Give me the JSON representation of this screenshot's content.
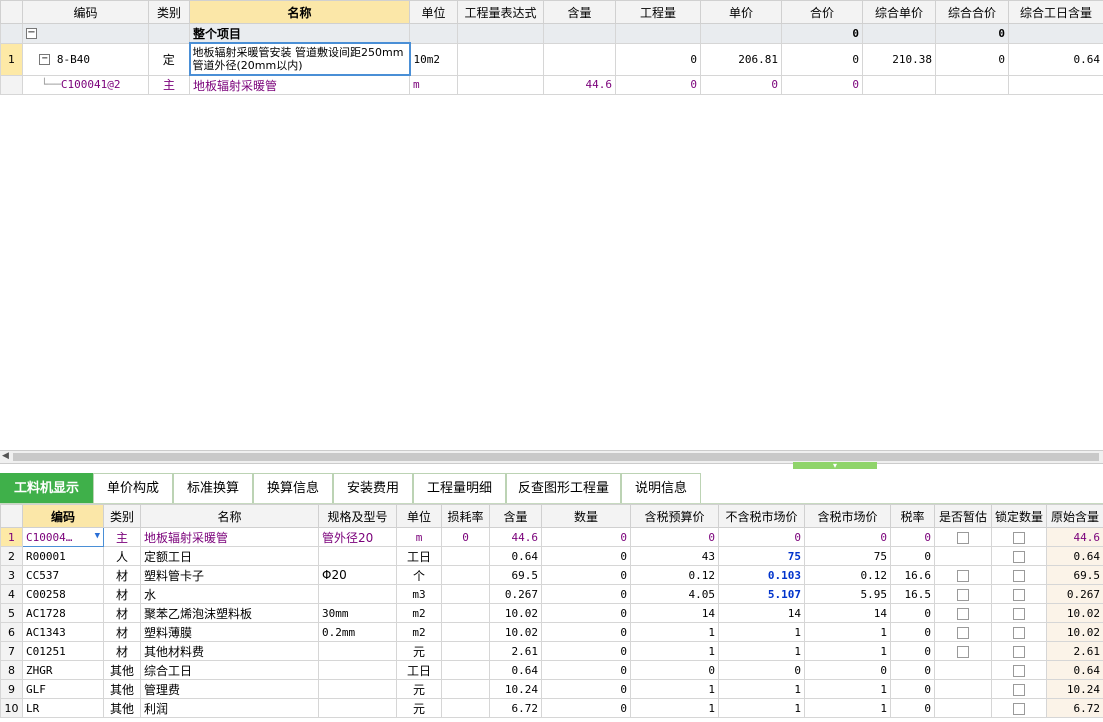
{
  "top_table": {
    "headers": [
      "编码",
      "类别",
      "名称",
      "单位",
      "工程量表达式",
      "含量",
      "工程量",
      "单价",
      "合价",
      "综合单价",
      "综合合价",
      "综合工日含量"
    ],
    "group_row": {
      "toggle": "−",
      "name": "整个项目",
      "合价": "0",
      "综合合价": "0"
    },
    "item_row": {
      "num": "1",
      "toggle": "−",
      "code": "8-B40",
      "type": "定",
      "name_line1": "地板辐射采暖管安装 管道敷设间距250mm",
      "name_line2": "管道外径(20mm以内)",
      "unit": "10m2",
      "expr": "",
      "qty_ratio": "",
      "qty": "0",
      "price": "206.81",
      "total": "0",
      "comp_price": "210.38",
      "comp_total": "0",
      "workday": "0.64"
    },
    "sub_row": {
      "code": "C100041@2",
      "type": "主",
      "name": "地板辐射采暖管",
      "unit": "m",
      "expr": "",
      "qty_ratio": "44.6",
      "qty": "0",
      "price": "0",
      "total": "0",
      "comp_price": "",
      "comp_total": "",
      "workday": ""
    }
  },
  "tabs": [
    "工料机显示",
    "单价构成",
    "标准换算",
    "换算信息",
    "安装费用",
    "工程量明细",
    "反查图形工程量",
    "说明信息"
  ],
  "bottom_table": {
    "headers": [
      "编码",
      "类别",
      "名称",
      "规格及型号",
      "单位",
      "损耗率",
      "含量",
      "数量",
      "含税预算价",
      "不含税市场价",
      "含税市场价",
      "税率",
      "是否暂估",
      "锁定数量",
      "原始含量"
    ],
    "rows": [
      {
        "n": "1",
        "code": "C10004…",
        "type": "主",
        "name": "地板辐射采暖管",
        "spec": "管外径20",
        "unit": "m",
        "loss": "0",
        "ratio": "44.6",
        "qty": "0",
        "budget": "0",
        "market": "0",
        "market_tax": "0",
        "tax": "0",
        "orig": "44.6"
      },
      {
        "n": "2",
        "code": "R00001",
        "type": "人",
        "name": "定额工日",
        "spec": "",
        "unit": "工日",
        "loss": "",
        "ratio": "0.64",
        "qty": "0",
        "budget": "43",
        "market": "75",
        "market_tax": "75",
        "tax": "0",
        "orig": "0.64"
      },
      {
        "n": "3",
        "code": "CC537",
        "type": "材",
        "name": "塑料管卡子",
        "spec": "Φ20",
        "unit": "个",
        "loss": "",
        "ratio": "69.5",
        "qty": "0",
        "budget": "0.12",
        "market": "0.103",
        "market_tax": "0.12",
        "tax": "16.6",
        "orig": "69.5"
      },
      {
        "n": "4",
        "code": "C00258",
        "type": "材",
        "name": "水",
        "spec": "",
        "unit": "m3",
        "loss": "",
        "ratio": "0.267",
        "qty": "0",
        "budget": "4.05",
        "market": "5.107",
        "market_tax": "5.95",
        "tax": "16.5",
        "orig": "0.267"
      },
      {
        "n": "5",
        "code": "AC1728",
        "type": "材",
        "name": "聚苯乙烯泡沫塑料板",
        "spec": "30mm",
        "unit": "m2",
        "loss": "",
        "ratio": "10.02",
        "qty": "0",
        "budget": "14",
        "market": "14",
        "market_tax": "14",
        "tax": "0",
        "orig": "10.02"
      },
      {
        "n": "6",
        "code": "AC1343",
        "type": "材",
        "name": "塑料薄膜",
        "spec": "0.2mm",
        "unit": "m2",
        "loss": "",
        "ratio": "10.02",
        "qty": "0",
        "budget": "1",
        "market": "1",
        "market_tax": "1",
        "tax": "0",
        "orig": "10.02"
      },
      {
        "n": "7",
        "code": "C01251",
        "type": "材",
        "name": "其他材料费",
        "spec": "",
        "unit": "元",
        "loss": "",
        "ratio": "2.61",
        "qty": "0",
        "budget": "1",
        "market": "1",
        "market_tax": "1",
        "tax": "0",
        "orig": "2.61"
      },
      {
        "n": "8",
        "code": "ZHGR",
        "type": "其他",
        "name": "综合工日",
        "spec": "",
        "unit": "工日",
        "loss": "",
        "ratio": "0.64",
        "qty": "0",
        "budget": "0",
        "market": "0",
        "market_tax": "0",
        "tax": "0",
        "orig": "0.64"
      },
      {
        "n": "9",
        "code": "GLF",
        "type": "其他",
        "name": "管理费",
        "spec": "",
        "unit": "元",
        "loss": "",
        "ratio": "10.24",
        "qty": "0",
        "budget": "1",
        "market": "1",
        "market_tax": "1",
        "tax": "0",
        "orig": "10.24"
      },
      {
        "n": "10",
        "code": "LR",
        "type": "其他",
        "name": "利润",
        "spec": "",
        "unit": "元",
        "loss": "",
        "ratio": "6.72",
        "qty": "0",
        "budget": "1",
        "market": "1",
        "market_tax": "1",
        "tax": "0",
        "orig": "6.72"
      }
    ]
  },
  "colors": {
    "accent": "#3fb04a",
    "selected_header": "#fbe7a8",
    "main_material": "#7a007a",
    "market_price_highlight": "#0033cc"
  }
}
